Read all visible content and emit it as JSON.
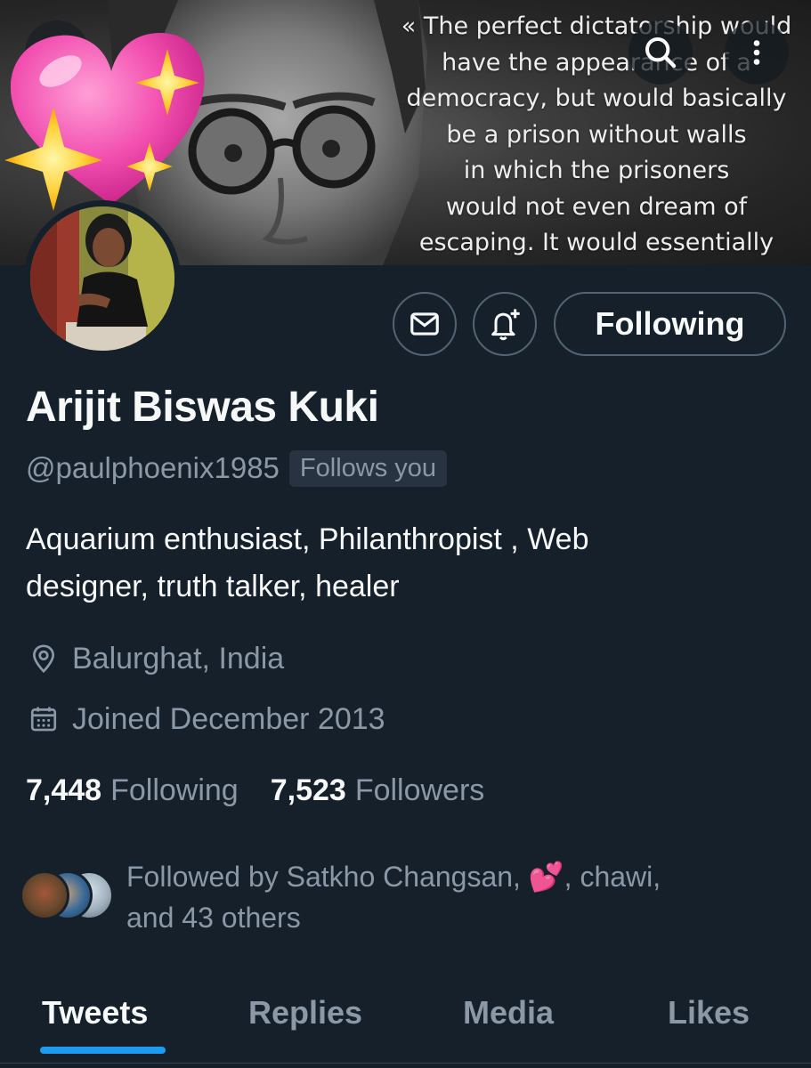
{
  "banner": {
    "quote_lines": [
      "« The perfect dictatorship would",
      "have the appearance of a",
      "democracy, but would basically",
      "be a prison without walls",
      "in which the prisoners",
      "would not even dream of",
      "escaping. It would essentially"
    ],
    "sticker_icon": "sparkling-heart-icon"
  },
  "toolbar": {
    "back_icon": "back-arrow-icon",
    "search_icon": "search-icon",
    "more_icon": "more-vertical-icon"
  },
  "profile": {
    "name": "Arijit Biswas Kuki",
    "handle": "@paulphoenix1985",
    "follows_you": "Follows you",
    "bio_line1": "Aquarium enthusiast, Philanthropist , Web",
    "bio_line2": "designer, truth talker, healer",
    "location": "Balurghat, India",
    "joined": "Joined December 2013"
  },
  "actions": {
    "message_icon": "mail-icon",
    "notify_icon": "bell-plus-icon",
    "following_label": "Following"
  },
  "stats": {
    "following_count": "7,448",
    "following_label": "Following",
    "followers_count": "7,523",
    "followers_label": "Followers"
  },
  "followed_by": {
    "prefix": "Followed by Satkho Changsan,",
    "emoji": "💕",
    "middle": ", chawi,",
    "suffix": "and 43 others"
  },
  "tabs": [
    {
      "label": "Tweets",
      "active": true
    },
    {
      "label": "Replies",
      "active": false
    },
    {
      "label": "Media",
      "active": false
    },
    {
      "label": "Likes",
      "active": false
    }
  ],
  "colors": {
    "background": "#15202b",
    "accent": "#1d9bf0",
    "secondary_text": "#8b98a5",
    "border": "#536471"
  }
}
